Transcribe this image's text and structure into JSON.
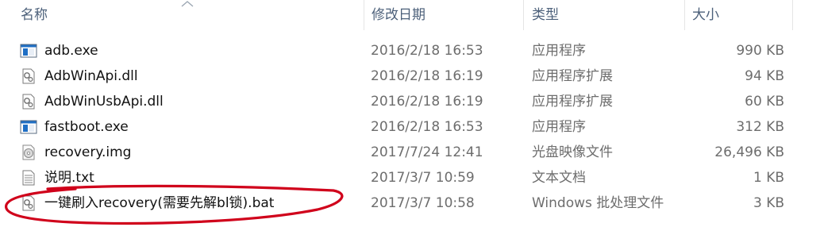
{
  "columns": {
    "name": "名称",
    "date": "修改日期",
    "type": "类型",
    "size": "大小"
  },
  "files": [
    {
      "name": "adb.exe",
      "date": "2016/2/18 16:53",
      "type": "应用程序",
      "size": "990 KB",
      "icon": "exe-app-icon"
    },
    {
      "name": "AdbWinApi.dll",
      "date": "2016/2/18 16:19",
      "type": "应用程序扩展",
      "size": "94 KB",
      "icon": "dll-gear-icon"
    },
    {
      "name": "AdbWinUsbApi.dll",
      "date": "2016/2/18 16:19",
      "type": "应用程序扩展",
      "size": "60 KB",
      "icon": "dll-gear-icon"
    },
    {
      "name": "fastboot.exe",
      "date": "2016/2/18 16:53",
      "type": "应用程序",
      "size": "312 KB",
      "icon": "exe-app-icon"
    },
    {
      "name": "recovery.img",
      "date": "2017/7/24 12:41",
      "type": "光盘映像文件",
      "size": "26,496 KB",
      "icon": "disc-image-icon"
    },
    {
      "name": "说明.txt",
      "date": "2017/3/7 10:59",
      "type": "文本文档",
      "size": "1 KB",
      "icon": "text-file-icon"
    },
    {
      "name": "一键刷入recovery(需要先解bl锁).bat",
      "date": "2017/3/7 10:58",
      "type": "Windows 批处理文件",
      "size": "3 KB",
      "icon": "batch-gear-icon"
    }
  ],
  "colors": {
    "header_text": "#4c607a",
    "secondary_text": "#6d6d6d",
    "annotation": "#d0021b",
    "exe_blue": "#1f6fc5"
  }
}
